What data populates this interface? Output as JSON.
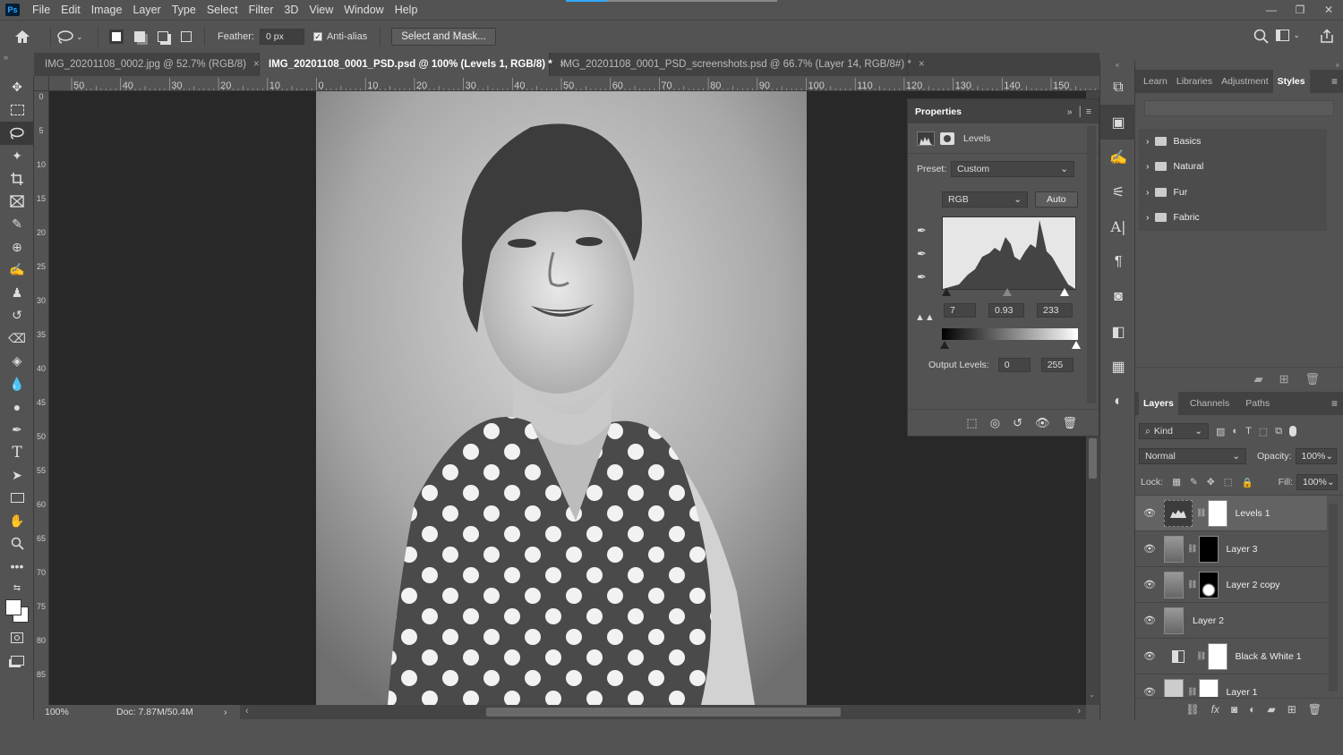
{
  "app": {
    "logo": "Ps"
  },
  "menu": [
    "File",
    "Edit",
    "Image",
    "Layer",
    "Type",
    "Select",
    "Filter",
    "3D",
    "View",
    "Window",
    "Help"
  ],
  "options": {
    "feather_label": "Feather:",
    "feather_value": "0 px",
    "antialias_label": "Anti-alias",
    "select_mask_label": "Select and Mask..."
  },
  "tabs": [
    {
      "label": "IMG_20201108_0002.jpg @ 52.7% (RGB/8)",
      "close": "×"
    },
    {
      "label": "IMG_20201108_0001_PSD.psd @ 100% (Levels 1, RGB/8) *",
      "close": "×"
    },
    {
      "label": "IMG_20201108_0001_PSD_screenshots.psd @ 66.7% (Layer 14, RGB/8#) *",
      "close": "×"
    }
  ],
  "ruler_top": [
    "50",
    "40",
    "30",
    "20",
    "10",
    "0",
    "10",
    "20",
    "30",
    "40",
    "50",
    "60",
    "70",
    "80",
    "90",
    "100",
    "110",
    "120",
    "130",
    "140",
    "150"
  ],
  "ruler_left": [
    "0",
    "5",
    "1 0",
    "1 5",
    "2 0",
    "2 5",
    "3 0",
    "3 5",
    "4 0",
    "4 5",
    "5 0",
    "5 5",
    "6 0",
    "6 5",
    "7 0",
    "7 5",
    "8 0",
    "8 5"
  ],
  "status": {
    "zoom": "100%",
    "doc": "Doc: 7.87M/50.4M",
    "arrow": "›"
  },
  "properties": {
    "title": "Properties",
    "adjustment": "Levels",
    "preset_label": "Preset:",
    "preset_value": "Custom",
    "channel": "RGB",
    "auto_label": "Auto",
    "input_black": "7",
    "input_gamma": "0.93",
    "input_white": "233",
    "output_label": "Output Levels:",
    "output_black": "0",
    "output_white": "255"
  },
  "right_tabs_top": [
    "Learn",
    "Libraries",
    "Adjustment",
    "Styles"
  ],
  "styles": [
    "Basics",
    "Natural",
    "Fur",
    "Fabric"
  ],
  "right_tabs_bottom": [
    "Layers",
    "Channels",
    "Paths"
  ],
  "layers_controls": {
    "kind": "Kind",
    "blend": "Normal",
    "opacity_label": "Opacity:",
    "opacity": "100%",
    "lock_label": "Lock:",
    "fill_label": "Fill:",
    "fill": "100%"
  },
  "layers": [
    {
      "name": "Levels 1"
    },
    {
      "name": "Layer 3"
    },
    {
      "name": "Layer 2 copy"
    },
    {
      "name": "Layer 2"
    },
    {
      "name": "Black & White 1"
    },
    {
      "name": "Layer 1"
    }
  ],
  "colors": {
    "accent": "#31a8ff",
    "bg": "#535353",
    "canvas": "#282828"
  }
}
